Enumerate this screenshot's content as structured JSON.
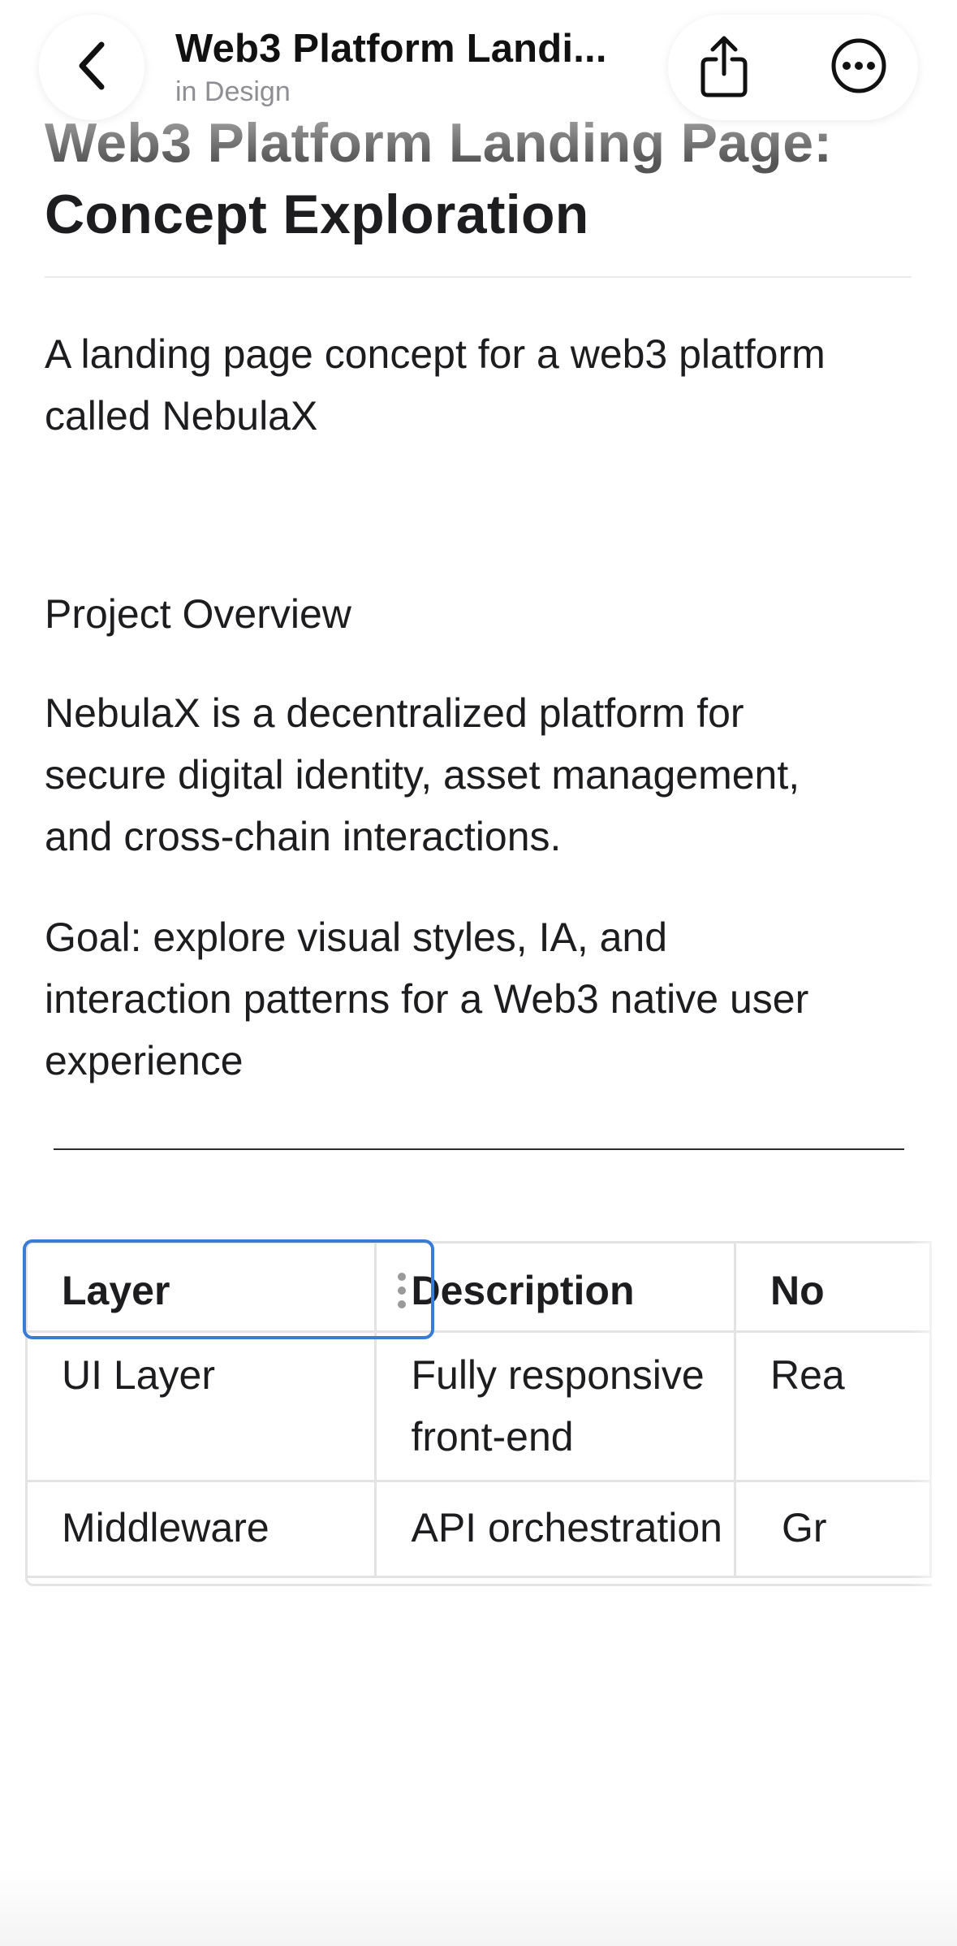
{
  "nav": {
    "title": "Web3 Platform Landi...",
    "subtitle": "in Design",
    "back_icon": "chevron-left-icon",
    "share_icon": "share-icon",
    "more_icon": "ellipsis-circle-icon"
  },
  "doc": {
    "title_line1": "Web3 Platform Landing Page:",
    "title_line2": "Concept Exploration",
    "intro_line1": "A landing page concept for a web3 platform",
    "intro_line2": "called NebulaX",
    "overview_heading": "Project Overview",
    "overview_line1": "NebulaX is a decentralized platform for",
    "overview_line2": "secure digital identity, asset management,",
    "overview_line3": "and cross-chain interactions.",
    "goal_line1": "Goal: explore visual styles, IA, and",
    "goal_line2": "interaction patterns for a Web3 native user",
    "goal_line3": "experience"
  },
  "table": {
    "headers": [
      "Layer",
      "Description",
      "No"
    ],
    "rows": [
      [
        "UI Layer",
        "Fully responsive front-end",
        "Rea"
      ],
      [
        "Middleware",
        "API orchestration",
        "Gr"
      ]
    ],
    "desc_r1_line1": "Fully responsive",
    "desc_r1_line2": "front-end"
  },
  "colors": {
    "selection": "#3a7bd5",
    "text": "#1d1d1f",
    "muted": "#8e8e93",
    "border": "#e3e3e3"
  }
}
